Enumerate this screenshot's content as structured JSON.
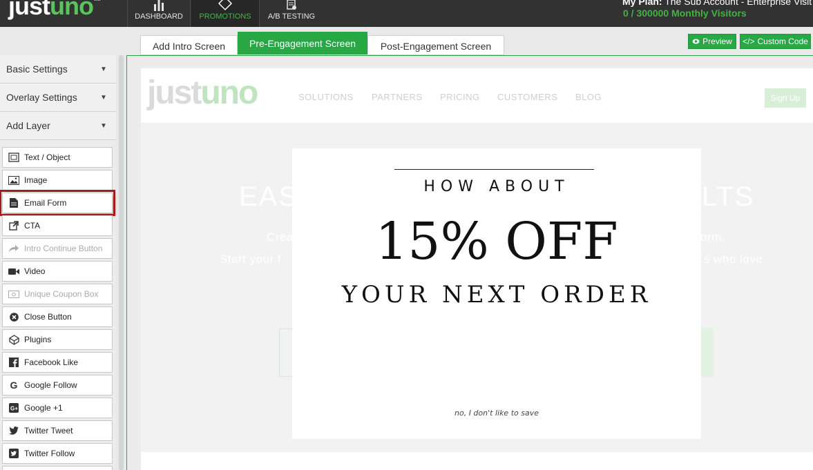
{
  "brand": {
    "logo_part1": "just",
    "logo_part2": "uno",
    "trademark": "TM"
  },
  "topnav": {
    "items": [
      {
        "label": "DASHBOARD"
      },
      {
        "label": "PROMOTIONS"
      },
      {
        "label": "A/B TESTING"
      }
    ],
    "plan_label": "My Plan:",
    "plan_value": "The Sub Account - Enterprise Visit",
    "visitors": "0 / 300000 Monthly Visitors"
  },
  "tabs": {
    "intro": "Add Intro Screen",
    "pre": "Pre-Engagement Screen",
    "post": "Post-Engagement Screen"
  },
  "actions": {
    "preview": "Preview",
    "custom_code": "Custom Code"
  },
  "sidebar": {
    "sections": [
      {
        "label": "Basic Settings"
      },
      {
        "label": "Overlay Settings"
      },
      {
        "label": "Add Layer"
      }
    ],
    "layers": [
      {
        "label": "Text / Object",
        "icon": "text-object-icon",
        "disabled": false
      },
      {
        "label": "Image",
        "icon": "image-icon",
        "disabled": false
      },
      {
        "label": "Email Form",
        "icon": "document-icon",
        "disabled": false
      },
      {
        "label": "CTA",
        "icon": "external-link-icon",
        "disabled": false
      },
      {
        "label": "Intro Continue Button",
        "icon": "share-arrow-icon",
        "disabled": true
      },
      {
        "label": "Video",
        "icon": "video-camera-icon",
        "disabled": false
      },
      {
        "label": "Unique Coupon Box",
        "icon": "coupon-icon",
        "disabled": true
      },
      {
        "label": "Close Button",
        "icon": "close-circle-icon",
        "disabled": false
      },
      {
        "label": "Plugins",
        "icon": "plugins-icon",
        "disabled": false
      },
      {
        "label": "Facebook Like",
        "icon": "facebook-icon",
        "disabled": false
      },
      {
        "label": "Google Follow",
        "icon": "google-icon",
        "disabled": false
      },
      {
        "label": "Google +1",
        "icon": "google-plus-icon",
        "disabled": false
      },
      {
        "label": "Twitter Tweet",
        "icon": "twitter-icon",
        "disabled": false
      },
      {
        "label": "Twitter Follow",
        "icon": "twitter-square-icon",
        "disabled": false
      }
    ]
  },
  "site_preview": {
    "logo_part1": "just",
    "logo_part2": "uno",
    "nav": [
      "SOLUTIONS",
      "PARTNERS",
      "PRICING",
      "CUSTOMERS",
      "BLOG"
    ],
    "signup": "Sign Up",
    "hero_head_left": "EAS",
    "hero_head_right": "LTS",
    "hero_sub1_left": "Crea",
    "hero_sub1_right": "orm.",
    "hero_sub2_left": "Start your f",
    "hero_sub2_right": "s who love"
  },
  "popup": {
    "how_about": "HOW ABOUT",
    "offer": "15% OFF",
    "next_order": "YOUR NEXT ORDER",
    "decline": "no, I don't like to save"
  },
  "colors": {
    "accent": "#28a745",
    "topbar": "#323232",
    "highlight": "#a31b1b"
  }
}
